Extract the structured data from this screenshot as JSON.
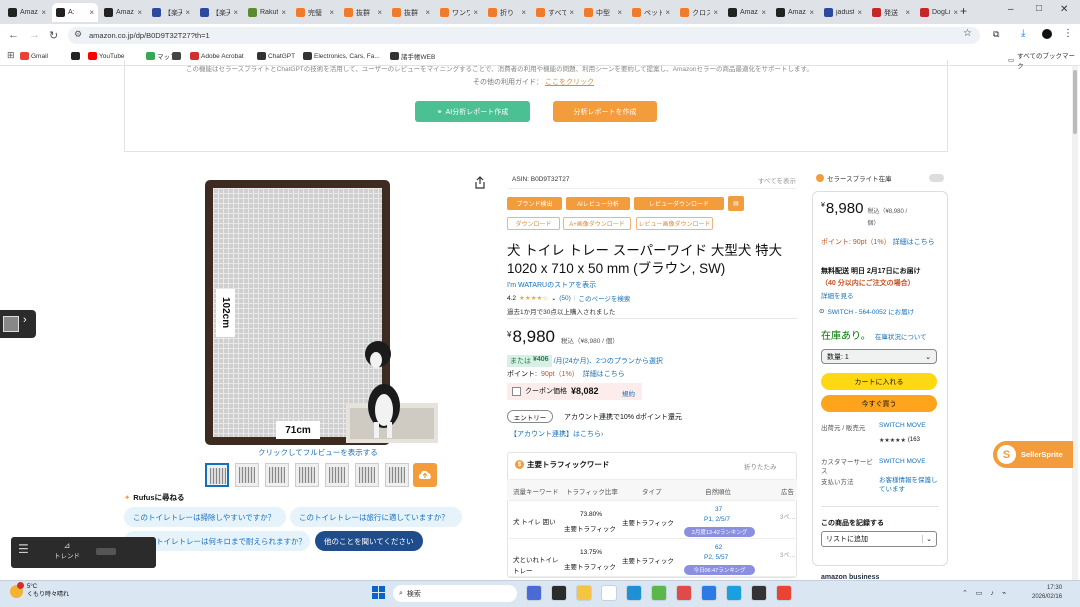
{
  "browser": {
    "tabs": [
      {
        "label": "Amazon",
        "color": "#222"
      },
      {
        "label": "A:",
        "color": "#222",
        "active": true
      },
      {
        "label": "Amazon",
        "color": "#222"
      },
      {
        "label": "【楽天】",
        "color": "#2c4a9c"
      },
      {
        "label": "【楽天】",
        "color": "#2c4a9c"
      },
      {
        "label": "Rakuten",
        "color": "#5a8b2e"
      },
      {
        "label": "完璧",
        "color": "#f07b2a"
      },
      {
        "label": "抜群",
        "color": "#f07b2a"
      },
      {
        "label": "抜群",
        "color": "#f07b2a"
      },
      {
        "label": "ワンワン",
        "color": "#f07b2a"
      },
      {
        "label": "折り",
        "color": "#f07b2a"
      },
      {
        "label": "すべて",
        "color": "#f07b2a"
      },
      {
        "label": "中型",
        "color": "#f07b2a"
      },
      {
        "label": "ペット",
        "color": "#f07b2a"
      },
      {
        "label": "クロス",
        "color": "#f07b2a"
      },
      {
        "label": "Amazon",
        "color": "#222"
      },
      {
        "label": "Amazon",
        "color": "#222"
      },
      {
        "label": "jadust",
        "color": "#2c4a9c"
      },
      {
        "label": "発送",
        "color": "#c62828"
      },
      {
        "label": "DogLi",
        "color": "#c62828"
      }
    ],
    "new_tab": "+",
    "window_controls": {
      "minimize": "–",
      "maximize": "□",
      "close": "✕"
    },
    "url": "amazon.co.jp/dp/B0D9T32T27?th=1",
    "bookmarks": [
      {
        "label": "Gmail",
        "color": "#ea4335"
      },
      {
        "label": "",
        "color": "#222"
      },
      {
        "label": "YouTube",
        "color": "#ff0000"
      },
      {
        "label": "マップ",
        "color": "#34a853"
      },
      {
        "label": "",
        "color": "#444"
      },
      {
        "label": "Adobe Acrobat",
        "color": "#d32f2f"
      },
      {
        "label": "ChatGPT",
        "color": "#333"
      },
      {
        "label": "Electronics, Cars, Fa...",
        "color": "#333"
      },
      {
        "label": "諸手帳WEB",
        "color": "#333"
      }
    ],
    "all_bookmarks": "すべてのブックマーク"
  },
  "top_card": {
    "notice": "この機能はセラースプライトとChatGPTの技術を活用して、ユーザーのレビューをマイニングすることで、消費者の利用や機能の問題、利用シーンを要約して提案し、Amazonセラーの商品最適化をサポートします。",
    "usage_guide": "その他の利用ガイド：",
    "click_here": "ここをクリック",
    "ai_button": "AI分析レポート作成",
    "report_button": "分析レポートを作成"
  },
  "gallery": {
    "size_vertical": "102cm",
    "size_horizontal": "71cm",
    "zoom_hint": "クリックしてフルビューを表示する",
    "rufus_title": "Rufusに尋ねる",
    "questions": [
      "このトイレトレーは掃除しやすいですか？",
      "このトイレトレーは旅行に適していますか？",
      "トイレトレーは何キロまで耐えられますか？",
      "他のことを聞いてください"
    ]
  },
  "product": {
    "asin": "ASIN: B0D9T32T27",
    "see_all": "すべてを表示",
    "tags_row1": [
      "ブランド検出",
      "AIレビュー分析",
      "レビューダウンロード"
    ],
    "tags_row2": [
      "ダウンロード",
      "A+画像ダウンロード",
      "レビュー画像ダウンロード"
    ],
    "title": "犬 トイレ トレー スーパーワイド 大型犬 特大 1020 x 710 x 50 mm (ブラウン, SW)",
    "store": "I'm WATARUのストアを表示",
    "rating": "4.2",
    "stars": "★★★★☆",
    "review_count": "(50)",
    "search_page": "このページを検索",
    "bought": "過去1か月で30点以上購入されました",
    "price_symbol": "¥",
    "price": "8,980",
    "tax_note": "税込（¥8,980 / 個）",
    "installment_prefix": "または",
    "installment_amount": "¥406",
    "installment_suffix": "/月(24か月)、2つのプランから選択",
    "points_label": "ポイント:",
    "points_value": "90pt（1%）",
    "points_link": "詳細はこちら",
    "coupon_label": "クーポン価格",
    "coupon_price": "¥8,082",
    "coupon_terms": "規約",
    "entry_button": "エントリー",
    "entry_text": "アカウント連携で10% dポイント還元",
    "account_link": "【アカウント連携】はこちら›"
  },
  "traffic": {
    "title": "主要トラフィックワード",
    "collapse": "折りたたみ",
    "columns": [
      "流量キーワード",
      "トラフィック比率",
      "タイプ",
      "自然順位",
      "広告"
    ],
    "rows": [
      {
        "keyword": "犬 トイレ 囲い",
        "ratio": "73.80%",
        "ratio_type": "主要トラフィック",
        "type": "主要トラフィック",
        "rank": "37",
        "rank_sub": "P1, 2/5/7",
        "badge": "2月度13-42ランキング",
        "ad": "3ペ…"
      },
      {
        "keyword": "犬といれトイレ トレー",
        "ratio": "13.75%",
        "ratio_type": "主要トラフィック",
        "type": "主要トラフィック",
        "rank": "62",
        "rank_sub": "P2, 5/57",
        "badge": "今日06:47ランキング",
        "ad": "3ペ…"
      }
    ]
  },
  "buybox": {
    "header": "セラースプライト在庫",
    "price": "8,980",
    "tax": "税込（¥8,980 / 個）",
    "points": "ポイント: 90pt（1%）",
    "points_link": "詳細はこちら",
    "delivery": "無料配送 明日 2月17日にお届け",
    "delivery_note": "（40 分以内にご注文の場合）",
    "details": "詳細を見る",
    "location": "SWITCH - 564-0052 にお届け",
    "stock": "在庫あり。",
    "stock_link": "在庫状況について",
    "quantity": "数量: 1",
    "cart": "カートに入れる",
    "buy_now": "今すぐ買う",
    "ship_from_label": "出荷元 / 販売元",
    "ship_from_value": "SWITCH MOVE",
    "rating_count": "(163",
    "seller_label": "カスタマーサービス",
    "seller_value": "SWITCH MOVE",
    "payment_label": "支払い方法",
    "payment_value": "お客様情報を保護しています",
    "record_title": "この商品を記録する",
    "list_select": "リストに追加",
    "business": "amazon business"
  },
  "extension": {
    "seller_sprite": "SellerSprite",
    "float_trend": "トレンド"
  },
  "taskbar": {
    "weather_temp": "5°C",
    "weather_desc": "くもり時々晴れ",
    "search": "検索",
    "time": "17:30",
    "date": "2026/02/16"
  }
}
